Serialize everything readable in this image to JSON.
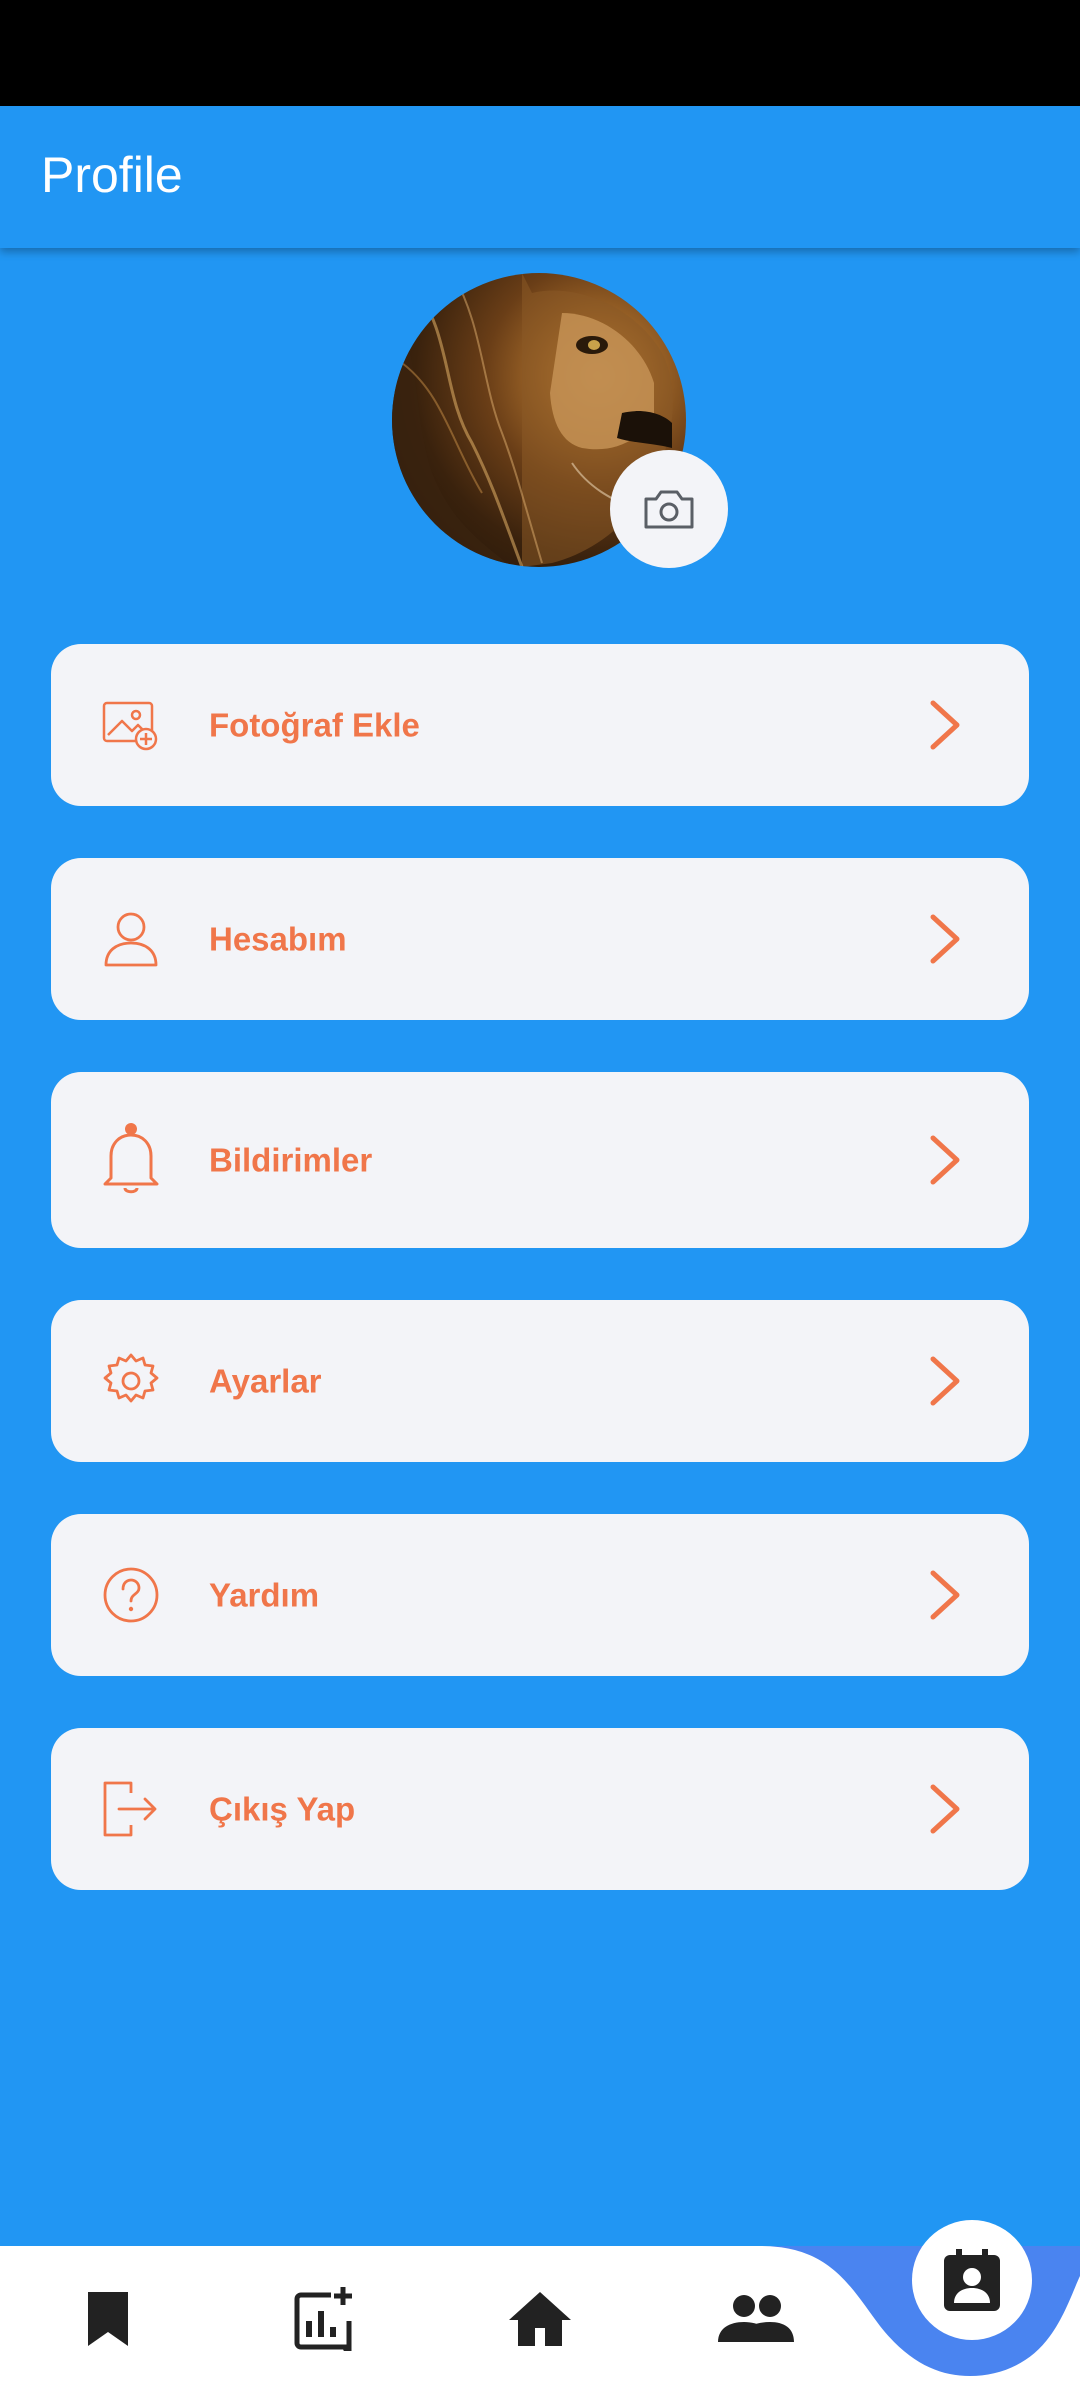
{
  "app_bar": {
    "title": "Profile"
  },
  "colors": {
    "primary": "#2196F3",
    "accent": "#F0764A",
    "card_bg": "#F3F4F8",
    "status_bar": "#000000",
    "nav_active_curve": "#4A84F0"
  },
  "profile": {
    "avatar_icon": "lion-photo",
    "camera_icon": "camera-icon"
  },
  "menu": [
    {
      "label": "Fotoğraf Ekle",
      "icon": "add-photo-icon"
    },
    {
      "label": "Hesabım",
      "icon": "user-icon"
    },
    {
      "label": "Bildirimler",
      "icon": "bell-icon"
    },
    {
      "label": "Ayarlar",
      "icon": "gear-icon"
    },
    {
      "label": "Yardım",
      "icon": "help-icon"
    },
    {
      "label": "Çıkış Yap",
      "icon": "logout-icon"
    }
  ],
  "bottom_nav": {
    "items": [
      {
        "icon": "bookmark-icon"
      },
      {
        "icon": "add-chart-icon"
      },
      {
        "icon": "home-icon"
      },
      {
        "icon": "people-icon"
      },
      {
        "icon": "contact-calendar-icon",
        "active": true
      }
    ]
  }
}
